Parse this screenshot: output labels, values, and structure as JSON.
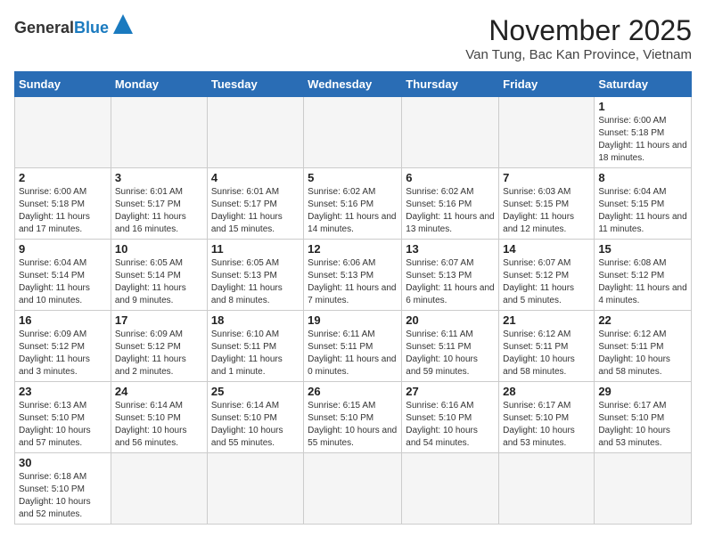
{
  "header": {
    "logo_general": "General",
    "logo_blue": "Blue",
    "month_title": "November 2025",
    "location": "Van Tung, Bac Kan Province, Vietnam"
  },
  "weekdays": [
    "Sunday",
    "Monday",
    "Tuesday",
    "Wednesday",
    "Thursday",
    "Friday",
    "Saturday"
  ],
  "weeks": [
    [
      {
        "day": "",
        "info": ""
      },
      {
        "day": "",
        "info": ""
      },
      {
        "day": "",
        "info": ""
      },
      {
        "day": "",
        "info": ""
      },
      {
        "day": "",
        "info": ""
      },
      {
        "day": "",
        "info": ""
      },
      {
        "day": "1",
        "info": "Sunrise: 6:00 AM\nSunset: 5:18 PM\nDaylight: 11 hours and 18 minutes."
      }
    ],
    [
      {
        "day": "2",
        "info": "Sunrise: 6:00 AM\nSunset: 5:18 PM\nDaylight: 11 hours and 17 minutes."
      },
      {
        "day": "3",
        "info": "Sunrise: 6:01 AM\nSunset: 5:17 PM\nDaylight: 11 hours and 16 minutes."
      },
      {
        "day": "4",
        "info": "Sunrise: 6:01 AM\nSunset: 5:17 PM\nDaylight: 11 hours and 15 minutes."
      },
      {
        "day": "5",
        "info": "Sunrise: 6:02 AM\nSunset: 5:16 PM\nDaylight: 11 hours and 14 minutes."
      },
      {
        "day": "6",
        "info": "Sunrise: 6:02 AM\nSunset: 5:16 PM\nDaylight: 11 hours and 13 minutes."
      },
      {
        "day": "7",
        "info": "Sunrise: 6:03 AM\nSunset: 5:15 PM\nDaylight: 11 hours and 12 minutes."
      },
      {
        "day": "8",
        "info": "Sunrise: 6:04 AM\nSunset: 5:15 PM\nDaylight: 11 hours and 11 minutes."
      }
    ],
    [
      {
        "day": "9",
        "info": "Sunrise: 6:04 AM\nSunset: 5:14 PM\nDaylight: 11 hours and 10 minutes."
      },
      {
        "day": "10",
        "info": "Sunrise: 6:05 AM\nSunset: 5:14 PM\nDaylight: 11 hours and 9 minutes."
      },
      {
        "day": "11",
        "info": "Sunrise: 6:05 AM\nSunset: 5:13 PM\nDaylight: 11 hours and 8 minutes."
      },
      {
        "day": "12",
        "info": "Sunrise: 6:06 AM\nSunset: 5:13 PM\nDaylight: 11 hours and 7 minutes."
      },
      {
        "day": "13",
        "info": "Sunrise: 6:07 AM\nSunset: 5:13 PM\nDaylight: 11 hours and 6 minutes."
      },
      {
        "day": "14",
        "info": "Sunrise: 6:07 AM\nSunset: 5:12 PM\nDaylight: 11 hours and 5 minutes."
      },
      {
        "day": "15",
        "info": "Sunrise: 6:08 AM\nSunset: 5:12 PM\nDaylight: 11 hours and 4 minutes."
      }
    ],
    [
      {
        "day": "16",
        "info": "Sunrise: 6:09 AM\nSunset: 5:12 PM\nDaylight: 11 hours and 3 minutes."
      },
      {
        "day": "17",
        "info": "Sunrise: 6:09 AM\nSunset: 5:12 PM\nDaylight: 11 hours and 2 minutes."
      },
      {
        "day": "18",
        "info": "Sunrise: 6:10 AM\nSunset: 5:11 PM\nDaylight: 11 hours and 1 minute."
      },
      {
        "day": "19",
        "info": "Sunrise: 6:11 AM\nSunset: 5:11 PM\nDaylight: 11 hours and 0 minutes."
      },
      {
        "day": "20",
        "info": "Sunrise: 6:11 AM\nSunset: 5:11 PM\nDaylight: 10 hours and 59 minutes."
      },
      {
        "day": "21",
        "info": "Sunrise: 6:12 AM\nSunset: 5:11 PM\nDaylight: 10 hours and 58 minutes."
      },
      {
        "day": "22",
        "info": "Sunrise: 6:12 AM\nSunset: 5:11 PM\nDaylight: 10 hours and 58 minutes."
      }
    ],
    [
      {
        "day": "23",
        "info": "Sunrise: 6:13 AM\nSunset: 5:10 PM\nDaylight: 10 hours and 57 minutes."
      },
      {
        "day": "24",
        "info": "Sunrise: 6:14 AM\nSunset: 5:10 PM\nDaylight: 10 hours and 56 minutes."
      },
      {
        "day": "25",
        "info": "Sunrise: 6:14 AM\nSunset: 5:10 PM\nDaylight: 10 hours and 55 minutes."
      },
      {
        "day": "26",
        "info": "Sunrise: 6:15 AM\nSunset: 5:10 PM\nDaylight: 10 hours and 55 minutes."
      },
      {
        "day": "27",
        "info": "Sunrise: 6:16 AM\nSunset: 5:10 PM\nDaylight: 10 hours and 54 minutes."
      },
      {
        "day": "28",
        "info": "Sunrise: 6:17 AM\nSunset: 5:10 PM\nDaylight: 10 hours and 53 minutes."
      },
      {
        "day": "29",
        "info": "Sunrise: 6:17 AM\nSunset: 5:10 PM\nDaylight: 10 hours and 53 minutes."
      }
    ],
    [
      {
        "day": "30",
        "info": "Sunrise: 6:18 AM\nSunset: 5:10 PM\nDaylight: 10 hours and 52 minutes."
      },
      {
        "day": "",
        "info": ""
      },
      {
        "day": "",
        "info": ""
      },
      {
        "day": "",
        "info": ""
      },
      {
        "day": "",
        "info": ""
      },
      {
        "day": "",
        "info": ""
      },
      {
        "day": "",
        "info": ""
      }
    ]
  ]
}
